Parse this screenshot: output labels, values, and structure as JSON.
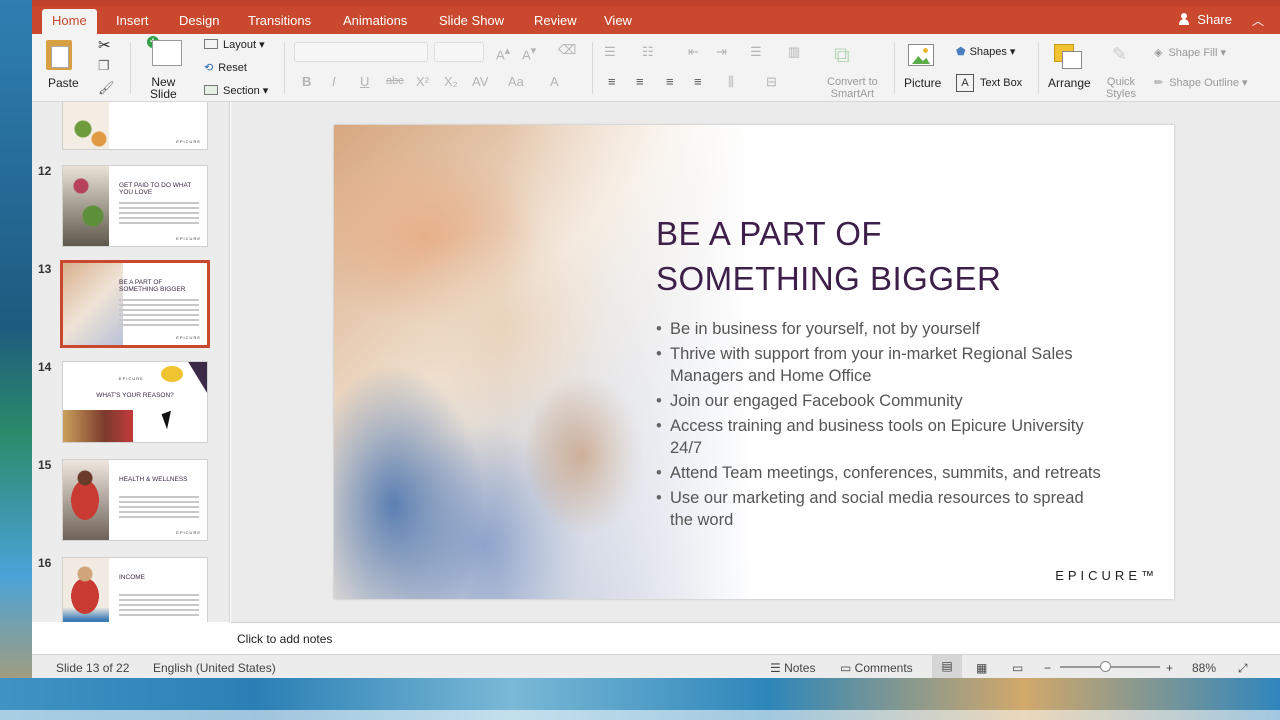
{
  "ribbon_tabs": [
    "Home",
    "Insert",
    "Design",
    "Transitions",
    "Animations",
    "Slide Show",
    "Review",
    "View"
  ],
  "share_label": "Share",
  "ribbon": {
    "paste": "Paste",
    "new_slide": "New\nSlide",
    "layout": "Layout",
    "reset": "Reset",
    "section": "Section",
    "convert_smartart": "Convert to\nSmartArt",
    "picture": "Picture",
    "shapes": "Shapes",
    "text_box": "Text Box",
    "arrange": "Arrange",
    "quick_styles": "Quick\nStyles",
    "shape_fill": "Shape Fill",
    "shape_outline": "Shape Outline"
  },
  "thumbnails": [
    {
      "num": "",
      "title": ""
    },
    {
      "num": "12",
      "title": "GET PAID TO DO WHAT YOU LOVE"
    },
    {
      "num": "13",
      "title": "BE A PART OF SOMETHING BIGGER"
    },
    {
      "num": "14",
      "title": "WHAT'S YOUR REASON?"
    },
    {
      "num": "15",
      "title": "HEALTH & WELLNESS"
    },
    {
      "num": "16",
      "title": "INCOME"
    }
  ],
  "slide": {
    "title_line1": "BE A PART OF",
    "title_line2": "SOMETHING BIGGER",
    "bullets": [
      "Be in business for yourself, not by yourself",
      "Thrive with support from your in-market Regional Sales Managers and Home Office",
      "Join our engaged Facebook Community",
      "Access training and business tools on Epicure University 24/7",
      "Attend Team meetings, conferences, summits, and retreats",
      "Use our marketing and social media resources to spread the word"
    ],
    "brand": "EPICURE™"
  },
  "notes_placeholder": "Click to add notes",
  "status": {
    "slide_info": "Slide 13 of 22",
    "language": "English (United States)",
    "notes": "Notes",
    "comments": "Comments",
    "zoom": "88%"
  }
}
